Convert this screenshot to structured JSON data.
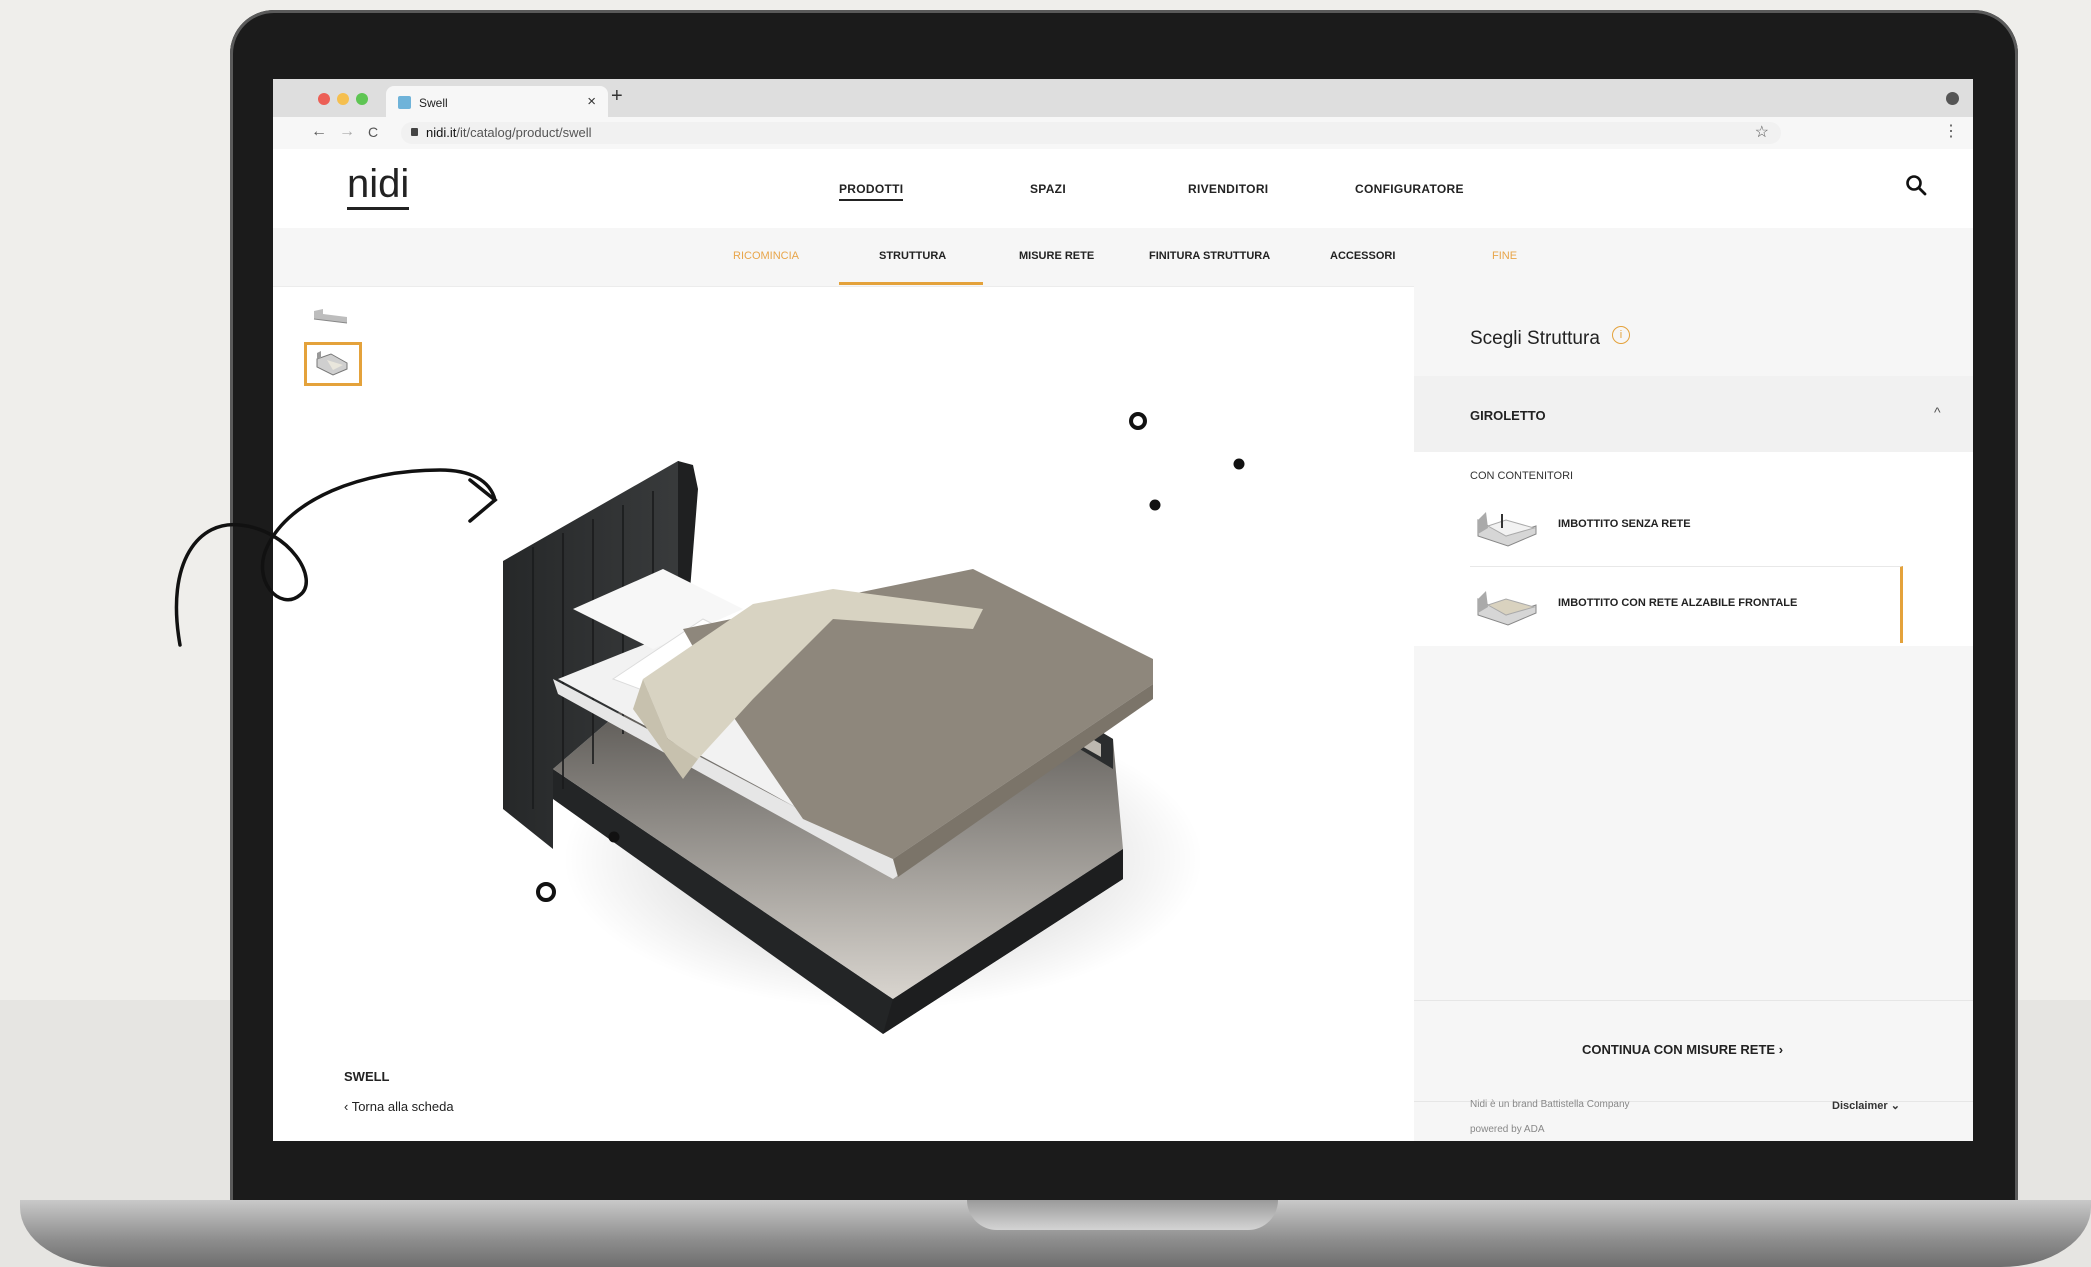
{
  "browser": {
    "tab_title": "Swell",
    "tab_close": "×",
    "new_tab": "+",
    "url_host": "nidi.it",
    "url_path": "/it/catalog/product/swell",
    "nav_back": "←",
    "nav_forward": "→",
    "nav_reload": "C",
    "bookmark": "☆",
    "menu": "⋮"
  },
  "site": {
    "logo": "nidi",
    "nav": [
      "PRODOTTI",
      "SPAZI",
      "RIVENDITORI",
      "CONFIGURATORE"
    ]
  },
  "steps": [
    "RICOMINCIA",
    "STRUTTURA",
    "MISURE RETE",
    "FINITURA STRUTTURA",
    "ACCESSORI",
    "FINE"
  ],
  "product": {
    "name": "SWELL",
    "back": "‹ Torna alla scheda"
  },
  "panel": {
    "title": "Scegli Struttura",
    "info": "i",
    "accordion_title": "GIROLETTO",
    "accordion_chevron": "^",
    "subheading": "CON CONTENITORI",
    "options": [
      "IMBOTTITO SENZA RETE",
      "IMBOTTITO CON RETE ALZABILE FRONTALE"
    ],
    "cta": "CONTINUA CON MISURE RETE  ›",
    "footer_line1": "Nidi è un brand Battistella Company",
    "footer_line2": "powered by ADA",
    "disclaimer": "Disclaimer  ⌄"
  },
  "colors": {
    "accent": "#e4a23b",
    "step_inactive": "#e8a54a",
    "bed_frame": "#2d2f30",
    "blanket": "#8e877c",
    "throw": "#d8d3c2"
  }
}
